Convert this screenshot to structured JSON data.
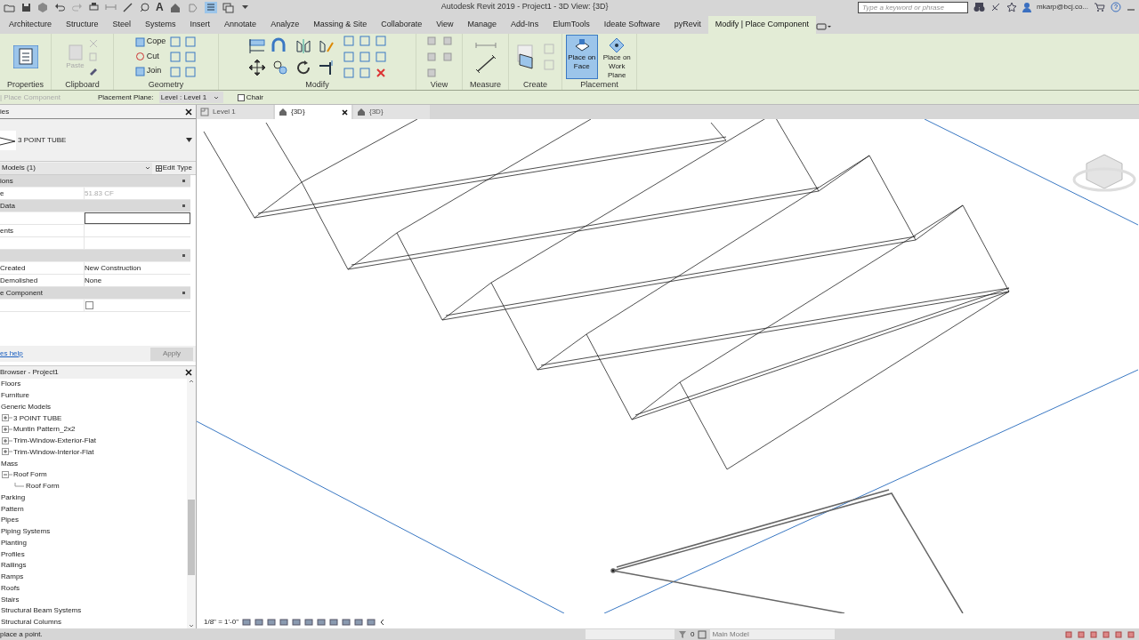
{
  "title_bar": {
    "text_tool_glyph": "A",
    "title": "Autodesk Revit 2019 - Project1 - 3D View: {3D}",
    "search": {
      "placeholder": "Type a keyword or phrase"
    },
    "user": "mkarp@bcj.co..."
  },
  "ribbon_tabs": [
    {
      "label": "Architecture",
      "selected": false
    },
    {
      "label": "Structure",
      "selected": false
    },
    {
      "label": "Steel",
      "selected": false
    },
    {
      "label": "Systems",
      "selected": false
    },
    {
      "label": "Insert",
      "selected": false
    },
    {
      "label": "Annotate",
      "selected": false
    },
    {
      "label": "Analyze",
      "selected": false
    },
    {
      "label": "Massing & Site",
      "selected": false
    },
    {
      "label": "Collaborate",
      "selected": false
    },
    {
      "label": "View",
      "selected": false
    },
    {
      "label": "Manage",
      "selected": false
    },
    {
      "label": "Add-Ins",
      "selected": false
    },
    {
      "label": "ElumTools",
      "selected": false
    },
    {
      "label": "Ideate Software",
      "selected": false
    },
    {
      "label": "pyRevit",
      "selected": false
    },
    {
      "label": "Modify | Place Component",
      "selected": true
    }
  ],
  "ribbon": {
    "paste": "Paste",
    "cope": "Cope",
    "cut": "Cut",
    "join": "Join",
    "panels": [
      {
        "label": "Properties"
      },
      {
        "label": "Clipboard"
      },
      {
        "label": "Geometry"
      },
      {
        "label": "Modify"
      },
      {
        "label": "View"
      },
      {
        "label": "Measure"
      },
      {
        "label": "Create"
      },
      {
        "label": "Placement"
      }
    ],
    "placement_buttons": [
      {
        "label": "Place on Face",
        "selected": true
      },
      {
        "label": "Place on Work Plane",
        "selected": false
      }
    ]
  },
  "options_bar": {
    "mode": "| Place Component",
    "plane_label": "Placement Plane:",
    "plane_value": "Level : Level 1",
    "chair": {
      "label": "Chair",
      "checked": false
    }
  },
  "properties": {
    "title": "ies",
    "type_name": "3 POINT TUBE",
    "selector": "Models (1)",
    "edit_type": "Edit Type",
    "rows": [
      {
        "kind": "header",
        "label": "ions"
      },
      {
        "kind": "row",
        "label": "e",
        "value": "51.83 CF",
        "disabled": true
      },
      {
        "kind": "header",
        "label": "Data"
      },
      {
        "kind": "input"
      },
      {
        "kind": "row",
        "label": "ents"
      },
      {
        "kind": "row"
      },
      {
        "kind": "header"
      },
      {
        "kind": "row",
        "label": "Created",
        "value": "New Construction",
        "disabled": false
      },
      {
        "kind": "row",
        "label": "Demolished",
        "value": "None",
        "disabled": false
      },
      {
        "kind": "header",
        "label": "e Component"
      },
      {
        "kind": "checkbox",
        "checked": false
      }
    ],
    "help_link": "es help",
    "apply": {
      "label": "Apply",
      "disabled": true
    }
  },
  "view_tabs": [
    {
      "label": "Level 1",
      "kind": "plan",
      "selected": false
    },
    {
      "label": "{3D}",
      "kind": "perspective",
      "selected": true
    },
    {
      "label": "{3D}",
      "kind": "perspective",
      "selected": false
    }
  ],
  "browser": {
    "title": "Browser - Project1",
    "items": [
      {
        "label": "Floors"
      },
      {
        "label": "Furniture"
      },
      {
        "label": "Generic Models",
        "children": [
          {
            "label": "3 POINT TUBE",
            "expanded": false
          },
          {
            "label": "Muntin Pattern_2x2",
            "expanded": false
          },
          {
            "label": "Trim-Window-Exterior-Flat",
            "expanded": false
          },
          {
            "label": "Trim-Window-Interior-Flat",
            "expanded": false
          }
        ]
      },
      {
        "label": "Mass",
        "children": [
          {
            "label": "Roof Form",
            "expanded": true,
            "children": [
              {
                "label": "Roof Form"
              }
            ]
          }
        ]
      },
      {
        "label": "Parking"
      },
      {
        "label": "Pattern"
      },
      {
        "label": "Pipes"
      },
      {
        "label": "Piping Systems"
      },
      {
        "label": "Planting"
      },
      {
        "label": "Profiles"
      },
      {
        "label": "Railings"
      },
      {
        "label": "Ramps"
      },
      {
        "label": "Roofs"
      },
      {
        "label": "Stairs"
      },
      {
        "label": "Structural Beam Systems"
      },
      {
        "label": "Structural Columns"
      }
    ]
  },
  "view_control_bar": {
    "scale": "1/8\" = 1'-0\""
  },
  "status_bar": {
    "prompt": "place a point.",
    "count": "0",
    "model": "Main Model"
  }
}
